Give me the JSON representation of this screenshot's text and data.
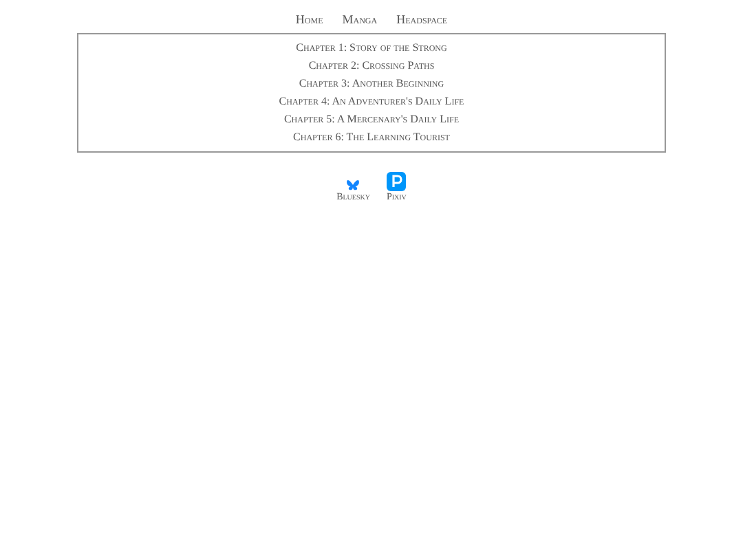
{
  "nav": [
    "Home",
    "Manga",
    "Headspace"
  ],
  "chapters": [
    "Chapter 1: Story of the Strong",
    "Chapter 2: Crossing Paths",
    "Chapter 3: Another Beginning",
    "Chapter 4: An Adventurer's Daily Life",
    "Chapter 5: A Mercenary's Daily Life",
    "Chapter 6: The Learning Tourist"
  ],
  "socials": [
    {
      "kind": "bluesky",
      "label": "Bluesky"
    },
    {
      "kind": "pixiv",
      "label": "Pixiv"
    }
  ]
}
